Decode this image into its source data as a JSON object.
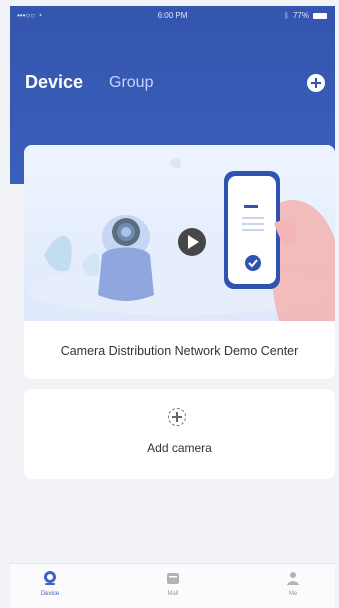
{
  "status_bar": {
    "signal": "•••○○",
    "time": "6:00 PM",
    "battery_text": "77%"
  },
  "header": {
    "tab_device": "Device",
    "tab_group": "Group",
    "add_icon": "plus-circle"
  },
  "demo_card": {
    "title": "Camera Distribution Network Demo Center"
  },
  "add_camera_card": {
    "label": "Add camera",
    "icon": "dashed-plus"
  },
  "bottom_nav": {
    "items": [
      {
        "label": "Device",
        "icon": "camera"
      },
      {
        "label": "Mall",
        "icon": "shop"
      },
      {
        "label": "Me",
        "icon": "user"
      }
    ],
    "active_index": 0
  },
  "colors": {
    "header_blue": "#3455ad",
    "active_nav": "#3e63c3",
    "inactive_nav": "#999999",
    "background": "#f2f3f7"
  }
}
